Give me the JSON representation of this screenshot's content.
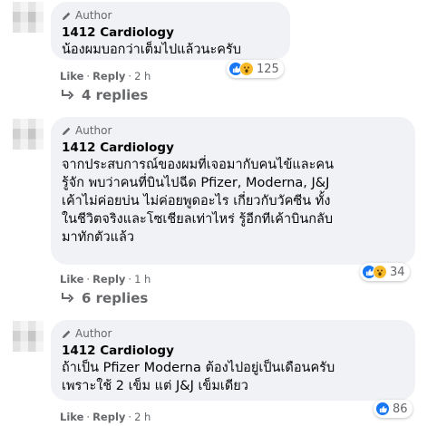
{
  "comments": [
    {
      "author_badge": "Author",
      "name": "1412 Cardiology",
      "lines": [
        "น้องผมบอกว่าเต็มไปแล้วนะครับ"
      ],
      "reactions": {
        "icons": [
          "like-icon",
          "wow-icon"
        ],
        "count": "125"
      },
      "actions": {
        "like": "Like",
        "reply": "Reply",
        "time": "2 h"
      },
      "replies": "4 replies"
    },
    {
      "author_badge": "Author",
      "name": "1412 Cardiology",
      "lines": [
        "จากประสบการณ์ของผมที่เจอมากับคนไข้และคน",
        "รู้จัก พบว่าคนที่บินไปฉีด Pfizer, Moderna, J&J",
        "เค้าไม่ค่อยบ่น ไม่ค่อยพูดอะไร เกี่ยวกับวัคซีน ทั้ง",
        "ในชีวิตจริงและโซเชียลเท่าไหร่ รู้อีกทีเค้าบินกลับ",
        "มาทักตัวแล้ว"
      ],
      "reactions": {
        "icons": [
          "like-icon",
          "wow-icon"
        ],
        "count": "34"
      },
      "actions": {
        "like": "Like",
        "reply": "Reply",
        "time": "1 h"
      },
      "replies": "6 replies"
    },
    {
      "author_badge": "Author",
      "name": "1412 Cardiology",
      "lines": [
        "ถ้าเป็น Pfizer Moderna ต้องไปอยู่เป็นเดือนครับ",
        "เพราะใช้ 2 เข็ม แต่ J&J เข็มเดียว"
      ],
      "reactions": {
        "icons": [
          "like-icon"
        ],
        "count": "86"
      },
      "actions": {
        "like": "Like",
        "reply": "Reply",
        "time": "2 h"
      }
    }
  ],
  "separator": "·",
  "colors": {
    "bubble": "#f0f2f5",
    "like": "#1877f2",
    "wow": "#f7b928",
    "muted": "#65676b"
  }
}
